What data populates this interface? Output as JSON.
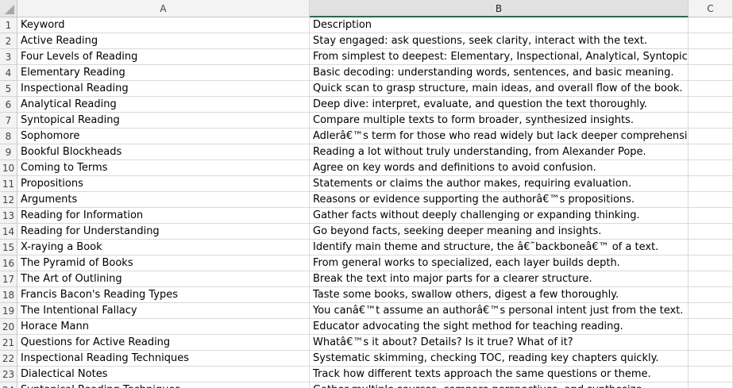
{
  "columns": [
    "A",
    "B",
    "C"
  ],
  "rows": [
    {
      "num": "1",
      "a": "Keyword",
      "b": "Description"
    },
    {
      "num": "2",
      "a": "Active Reading",
      "b": "Stay engaged: ask questions, seek clarity, interact with the text."
    },
    {
      "num": "3",
      "a": "Four Levels of Reading",
      "b": "From simplest to deepest: Elementary, Inspectional, Analytical, Syntopical."
    },
    {
      "num": "4",
      "a": "Elementary Reading",
      "b": "Basic decoding: understanding words, sentences, and basic meaning."
    },
    {
      "num": "5",
      "a": "Inspectional Reading",
      "b": "Quick scan to grasp structure, main ideas, and overall flow of the book."
    },
    {
      "num": "6",
      "a": "Analytical Reading",
      "b": "Deep dive: interpret, evaluate, and question the text thoroughly."
    },
    {
      "num": "7",
      "a": "Syntopical Reading",
      "b": "Compare multiple texts to form broader, synthesized insights."
    },
    {
      "num": "8",
      "a": "Sophomore",
      "b": "Adlerâ€™s term for those who read widely but lack deeper comprehension."
    },
    {
      "num": "9",
      "a": "Bookful Blockheads",
      "b": "Reading a lot without truly understanding, from Alexander Pope."
    },
    {
      "num": "10",
      "a": "Coming to Terms",
      "b": "Agree on key words and definitions to avoid confusion."
    },
    {
      "num": "11",
      "a": "Propositions",
      "b": "Statements or claims the author makes, requiring evaluation."
    },
    {
      "num": "12",
      "a": "Arguments",
      "b": "Reasons or evidence supporting the authorâ€™s propositions."
    },
    {
      "num": "13",
      "a": "Reading for Information",
      "b": "Gather facts without deeply challenging or expanding thinking."
    },
    {
      "num": "14",
      "a": "Reading for Understanding",
      "b": "Go beyond facts, seeking deeper meaning and insights."
    },
    {
      "num": "15",
      "a": "X-raying a Book",
      "b": "Identify main theme and structure, the â€˜backboneâ€™ of a text."
    },
    {
      "num": "16",
      "a": "The Pyramid of Books",
      "b": "From general works to specialized, each layer builds depth."
    },
    {
      "num": "17",
      "a": "The Art of Outlining",
      "b": "Break the text into major parts for a clearer structure."
    },
    {
      "num": "18",
      "a": "Francis Bacon's Reading Types",
      "b": "Taste some books, swallow others, digest a few thoroughly."
    },
    {
      "num": "19",
      "a": "The Intentional Fallacy",
      "b": "You canâ€™t assume an authorâ€™s personal intent just from the text."
    },
    {
      "num": "20",
      "a": "Horace Mann",
      "b": "Educator advocating the sight method for teaching reading."
    },
    {
      "num": "21",
      "a": "Questions for Active Reading",
      "b": "Whatâ€™s it about? Details? Is it true? What of it?"
    },
    {
      "num": "22",
      "a": "Inspectional Reading Techniques",
      "b": "Systematic skimming, checking TOC, reading key chapters quickly."
    },
    {
      "num": "23",
      "a": "Dialectical Notes",
      "b": "Track how different texts approach the same questions or theme."
    },
    {
      "num": "24",
      "a": "Syntopical Reading Techniques",
      "b": "Gather multiple sources, compare perspectives, and synthesize."
    }
  ]
}
